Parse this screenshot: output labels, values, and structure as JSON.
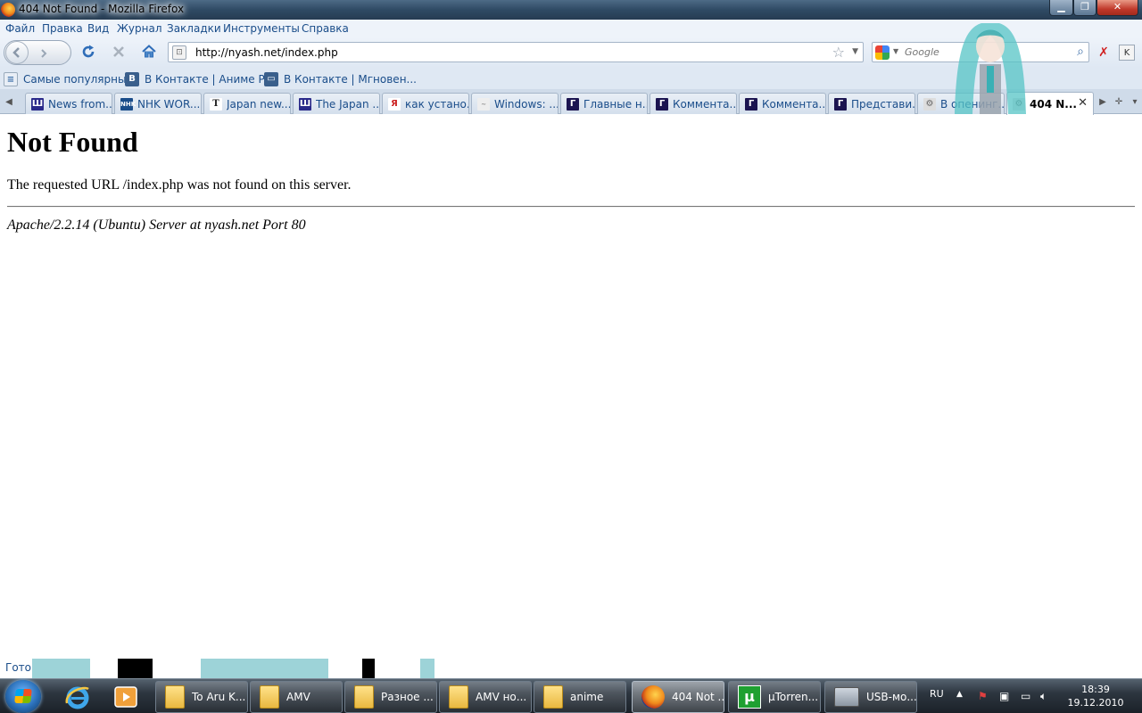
{
  "window": {
    "title": "404 Not Found - Mozilla Firefox"
  },
  "menu": [
    "Файл",
    "Правка",
    "Вид",
    "Журнал",
    "Закладки",
    "Инструменты",
    "Справка"
  ],
  "nav": {
    "url": "http://nyash.net/index.php",
    "search_placeholder": "Google"
  },
  "bookmarks": [
    {
      "label": "Самые популярные",
      "icon": "rss-icon"
    },
    {
      "label": "В Контакте | Аниме Р...",
      "icon": "vk-icon"
    },
    {
      "label": "В Контакте | Мгновен...",
      "icon": "chat-icon"
    }
  ],
  "tabs": [
    {
      "label": "News from...",
      "icon": "yu-icon",
      "color": "#2a2a8a"
    },
    {
      "label": "NHK WOR...",
      "icon": "nhk-icon",
      "color": "#1a4d8a"
    },
    {
      "label": "Japan new...",
      "icon": "t-icon",
      "color": "#222222"
    },
    {
      "label": "The Japan ...",
      "icon": "yu-icon",
      "color": "#2a2a8a"
    },
    {
      "label": "как устано...",
      "icon": "yandex-icon",
      "color": "#cc2222"
    },
    {
      "label": "Windows: ...",
      "icon": "site-icon",
      "color": "#888888"
    },
    {
      "label": "Главные н...",
      "icon": "g-icon",
      "color": "#1b1450"
    },
    {
      "label": "Коммента...",
      "icon": "g-icon",
      "color": "#1b1450"
    },
    {
      "label": "Коммента...",
      "icon": "g-icon",
      "color": "#1b1450"
    },
    {
      "label": "Представи...",
      "icon": "g-icon",
      "color": "#1b1450"
    },
    {
      "label": "В опенинг...",
      "icon": "page-icon",
      "color": "#888888"
    },
    {
      "label": "404 N...",
      "icon": "page-icon",
      "color": "#888888",
      "active": true
    }
  ],
  "page": {
    "heading": "Not Found",
    "message": "The requested URL /index.php was not found on this server.",
    "server": "Apache/2.2.14 (Ubuntu) Server at nyash.net Port 80"
  },
  "status": {
    "text": "Готово"
  },
  "taskbar": {
    "tasks": [
      {
        "label": "To Aru K...",
        "icon": "folder-icon"
      },
      {
        "label": "AMV",
        "icon": "folder-icon"
      },
      {
        "label": "Разное ...",
        "icon": "folder-icon"
      },
      {
        "label": "AMV но...",
        "icon": "folder-icon"
      },
      {
        "label": "anime",
        "icon": "folder-icon"
      },
      {
        "label": "404 Not ...",
        "icon": "firefox-icon",
        "active": true
      },
      {
        "label": "µTorren...",
        "icon": "utorrent-icon"
      },
      {
        "label": "USB-мо...",
        "icon": "usb-icon"
      }
    ],
    "lang": "RU",
    "time": "18:39",
    "date": "19.12.2010"
  }
}
